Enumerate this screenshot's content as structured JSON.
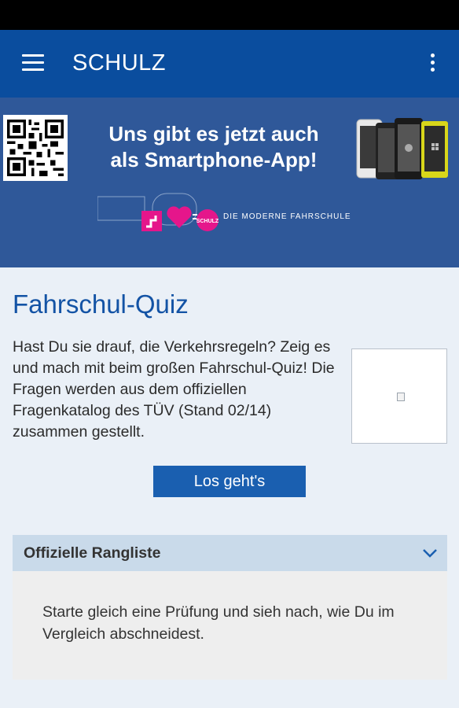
{
  "app_bar": {
    "title": "SCHULZ",
    "menu_icon": "hamburger-menu-icon",
    "overflow_icon": "more-vertical-icon",
    "color": "#0a4d9e"
  },
  "banner": {
    "headline": "Uns gibt es jetzt auch als Smartphone-App!",
    "brand_label": "SCHULZ",
    "tagline": "DIE MODERNE FAHRSCHULE",
    "color": "#2f5899"
  },
  "main": {
    "title": "Fahrschul-Quiz",
    "intro": "Hast Du sie drauf, die Verkehrsregeln? Zeig es und mach mit beim großen Fahrschul-Quiz! Die Fragen werden aus dem offiziellen Fragenkatalog des TÜV (Stand 02/14) zusammen gestellt.",
    "start_button": "Los geht's"
  },
  "ranking": {
    "header": "Offizielle Rangliste",
    "body": "Starte gleich eine Prüfung und sieh nach, wie Du im Vergleich abschneidest.",
    "chevron_icon": "chevron-down-icon"
  }
}
